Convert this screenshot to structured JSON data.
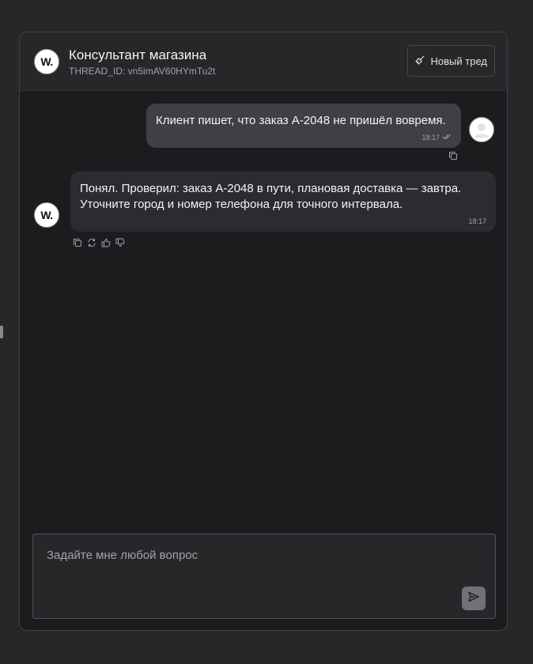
{
  "header": {
    "logo_text": "W.",
    "title": "Консультант магазина",
    "thread_id": "THREAD_ID: vn5imAV60HYmTu2t",
    "new_thread_label": "Новый тред"
  },
  "messages": {
    "user": {
      "text": "Клиент пишет, что заказ A-2048 не пришёл вовремя.",
      "time": "18:17",
      "read_status_icon": "double-check-icon"
    },
    "assistant": {
      "avatar_text": "W.",
      "line1": "Понял. Проверил: заказ A-2048 в пути, плановая доставка — завтра.",
      "line2": "Уточните город и номер телефона для точного интервала.",
      "time": "18:17",
      "action_icons": [
        "copy-icon",
        "refresh-icon",
        "thumbs-up-icon",
        "thumbs-down-icon"
      ]
    }
  },
  "composer": {
    "placeholder": "Задайте мне любой вопрос",
    "value": ""
  },
  "colors": {
    "page_bg": "#27272a",
    "chat_bg": "#1c1c1f",
    "user_bubble": "#3f3f46",
    "bot_bubble": "#2c2c30",
    "send_button": "#71717a"
  }
}
